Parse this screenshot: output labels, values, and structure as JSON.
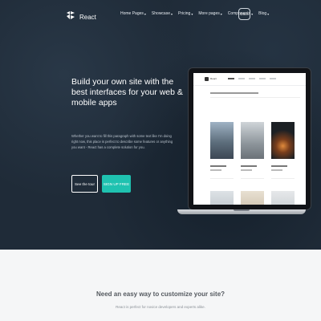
{
  "brand": {
    "name": "React",
    "icon": "react-logo-icon"
  },
  "nav": {
    "items": [
      {
        "label": "Home Pages",
        "has_dropdown": true
      },
      {
        "label": "Showcase",
        "has_dropdown": true
      },
      {
        "label": "Pricing",
        "has_dropdown": true
      },
      {
        "label": "More pages",
        "has_dropdown": true
      },
      {
        "label": "Components",
        "has_dropdown": true
      },
      {
        "label": "Blog",
        "has_dropdown": true
      }
    ],
    "docs_label": "Docs"
  },
  "hero": {
    "headline": "Build your own site with the best interfaces for your web & mobile apps",
    "subtext": "Whether you want to fill this paragraph with some text like I'm doing right now, this place is perfect to describe some features or anything you want - React has a complete solution for you.",
    "tour_label": "See the tour",
    "signup_label": "SIGN UP FREE"
  },
  "section2": {
    "title": "Need an easy way to customize your site?",
    "subtitle": "React is perfect for novice developers and experts alike."
  },
  "colors": {
    "hero_bg": "#1f2b38",
    "accent": "#1fc2b0",
    "section_bg": "#f5f6f7"
  }
}
